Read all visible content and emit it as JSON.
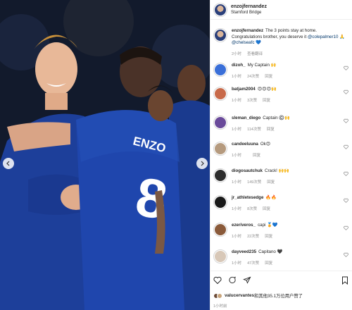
{
  "post": {
    "username": "enzojfernandez",
    "location": "Stamford Bridge",
    "caption_user": "enzojfernandez",
    "caption_text": "The 3 points stay at home. Congratulations brother, you deserve it ",
    "caption_mention1": "@colepalmer10",
    "caption_mention2": "@chelseafc",
    "caption_emoji": "💙",
    "caption_time": "2小时",
    "caption_see_translation": "查看翻译"
  },
  "comments": [
    {
      "user": "dizoh_",
      "text": "My Captain 🙌",
      "time": "1小时",
      "likes": "24次赞",
      "reply": "回复",
      "avatar_color": "#3a6fd8"
    },
    {
      "user": "batjam2004",
      "text": "😍😍😍🙌",
      "time": "1小时",
      "likes": "3次赞",
      "reply": "回复",
      "avatar_color": "#c86a4a"
    },
    {
      "user": "sleman_diego",
      "text": "Captain ©️🙌",
      "time": "1小时",
      "likes": "114次赞",
      "reply": "回复",
      "avatar_color": "#6a4a9a"
    },
    {
      "user": "candeeluuna",
      "text": "Ok😍",
      "time": "1小时",
      "likes": "",
      "reply": "回复",
      "avatar_color": "#b59a7e"
    },
    {
      "user": "diogosautchuk",
      "text": "Crack! 🙌🙌",
      "time": "1小时",
      "likes": "149次赞",
      "reply": "回复",
      "avatar_color": "#2c2c2c"
    },
    {
      "user": "jr_athletesedge",
      "text": "🔥🔥",
      "time": "1小时",
      "likes": "8次赞",
      "reply": "回复",
      "avatar_color": "#1a1a1a"
    },
    {
      "user": "ezeriveros_",
      "text": "capi 🏅💙",
      "time": "1小时",
      "likes": "22次赞",
      "reply": "回复",
      "avatar_color": "#8a5a3a"
    },
    {
      "user": "dayveed235",
      "text": "Capitano 🖤",
      "time": "1小时",
      "likes": "47次赞",
      "reply": "回复",
      "avatar_color": "#d8c8b8"
    }
  ],
  "footer": {
    "liked_by_user": "valucervantes",
    "liked_by_text": "和其他35.1万位用户赞了",
    "timestamp": "1小时前"
  },
  "photo": {
    "player1_number": "8",
    "player1_name": "ENZO"
  },
  "colors": {
    "jersey": "#1d3f9a",
    "mention": "#00376b",
    "meta": "#8e8e8e"
  }
}
